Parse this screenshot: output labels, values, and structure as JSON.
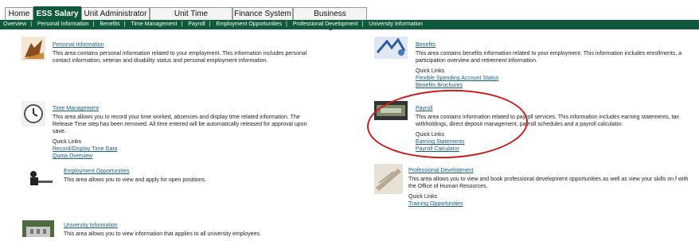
{
  "tabs": [
    {
      "label": "Home",
      "active": false
    },
    {
      "label": "ESS Salary",
      "active": true
    },
    {
      "label": "Unit Administrator",
      "active": false
    },
    {
      "label": "Unit Time Administrator",
      "active": false
    },
    {
      "label": "Finance System",
      "active": false
    },
    {
      "label": "Business Intelligence",
      "active": false
    }
  ],
  "subnav": [
    "Overview",
    "Personal Information",
    "Benefits",
    "Time Management",
    "Payroll",
    "Employment Opportunities",
    "Professional Development",
    "University Information"
  ],
  "subnav_separator": "|",
  "personal": {
    "title": "Personal Information",
    "desc": "This area contains personal information related to your employment. This information includes personal contact information, veteran and disability status and personal employment information."
  },
  "benefits": {
    "title": "Benefits",
    "desc": "This area contains benefits information related to your employment. This information includes enrollments, a participation overview and retirement information.",
    "quick_links_label": "Quick Links",
    "links": [
      "Flexible Spending Account Status",
      "Benefits Brochures"
    ]
  },
  "time": {
    "title": "Time Management",
    "desc": "This area allows you to record your time worked, absences and display time related information.  The Release Time step has been removed.  All time entered will be automatically released for approval upon save.",
    "quick_links_label": "Quick Links",
    "links": [
      "Record/Display Time Data",
      "Quota Overview"
    ]
  },
  "payroll": {
    "title": "Payroll",
    "desc": "This area contains information related to payroll services. This information includes earning statements, tax withholdings, direct deposit management, payroll schedules and a payroll calculator.",
    "quick_links_label": "Quick Links",
    "links": [
      "Earning Statements",
      "Payroll Calculator"
    ]
  },
  "employment": {
    "title": "Employment Opportunities",
    "desc": "This area allows you to view and apply for open positions."
  },
  "profdev": {
    "title": "Professional Development",
    "desc": "This area allows you to view and book professional development opportunities as well as view your skills on f with the Office of Human Resources.",
    "quick_links_label": "Quick Links",
    "links": [
      "Training Opportunities"
    ]
  },
  "university": {
    "title": "University Information",
    "desc": "This area allows you to view information that applies to all university employees."
  },
  "colors": {
    "accent": "#0f5a3c",
    "link": "#1a5e8a",
    "highlight_oval": "#d01b1b"
  }
}
